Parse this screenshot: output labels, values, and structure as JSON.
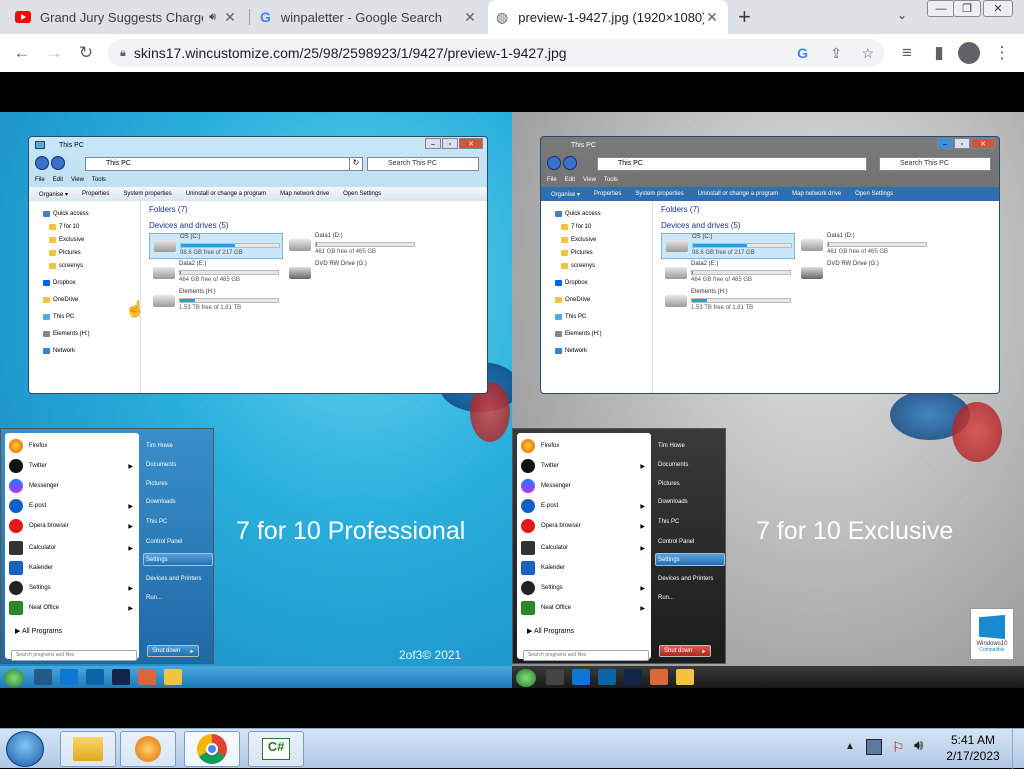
{
  "browser": {
    "tabs": [
      {
        "title": "Grand Jury Suggests Charge",
        "icon": "youtube-icon",
        "audio": true
      },
      {
        "title": "winpaletter - Google Search",
        "icon": "google-icon"
      },
      {
        "title": "preview-1-9427.jpg (1920×1080)",
        "icon": "globe-icon"
      }
    ],
    "new_tab": "+",
    "url": "skins17.wincustomize.com/25/98/2598923/1/9427/preview-1-9427.jpg"
  },
  "preview": {
    "left": {
      "explorer": {
        "title": "This PC",
        "address": "This PC",
        "search_placeholder": "Search This PC",
        "menu": [
          "File",
          "Edit",
          "View",
          "Tools"
        ],
        "commands": [
          "Organise ▾",
          "Properties",
          "System properties",
          "Uninstall or change a program",
          "Map network drive",
          "Open Settings"
        ],
        "nav": [
          "Quick access",
          "7 for 10",
          "Exclusive",
          "Pictures",
          "screenys",
          "Dropbox",
          "OneDrive",
          "This PC",
          "Elements (H:)",
          "Network"
        ],
        "folders_header": "Folders (7)",
        "devices_header": "Devices and drives (5)",
        "drives": [
          {
            "name": "OS (C:)",
            "free": "98.6 GB free of 217 GB",
            "fill": 0.55,
            "selected": true
          },
          {
            "name": "Data1 (D:)",
            "free": "461 GB free of 465 GB",
            "fill": 0.01
          },
          {
            "name": "Data2 (E:)",
            "free": "464 GB free of 465 GB",
            "fill": 0.01
          },
          {
            "name": "DVD RW Drive (G:)",
            "free": "",
            "fill": null
          },
          {
            "name": "Elements (H:)",
            "free": "1.53 TB free of 1.81 TB",
            "fill": 0.15
          }
        ]
      },
      "start_menu": {
        "apps": [
          "Firefox",
          "Twitter",
          "Messenger",
          "E-post",
          "Opera browser",
          "Calculator",
          "Kalender",
          "Settings",
          "Neat Office"
        ],
        "all_programs": "All Programs",
        "search_placeholder": "Search programs and files",
        "right": [
          "Tim Howe",
          "Documents",
          "Pictures",
          "Downloads",
          "This PC",
          "Control Panel",
          "Settings",
          "Devices and Printers",
          "Run..."
        ],
        "shutdown": "Shut down"
      },
      "caption": "7 for 10 Professional",
      "credit": "2of3© 2021"
    },
    "right": {
      "caption": "7 for 10 Exclusive",
      "badge_line1": "Windows10",
      "badge_line2": "Compatible"
    }
  },
  "taskbar": {
    "time": "5:41 AM",
    "date": "2/17/2023",
    "apps": [
      "start-orb",
      "file-explorer",
      "media-player",
      "chrome",
      "csharp-app"
    ]
  },
  "colors": {
    "accent_blue": "#1a8ad0",
    "exclusive_cmdbar": "#2e6fb0",
    "red_close": "#d8503a"
  }
}
